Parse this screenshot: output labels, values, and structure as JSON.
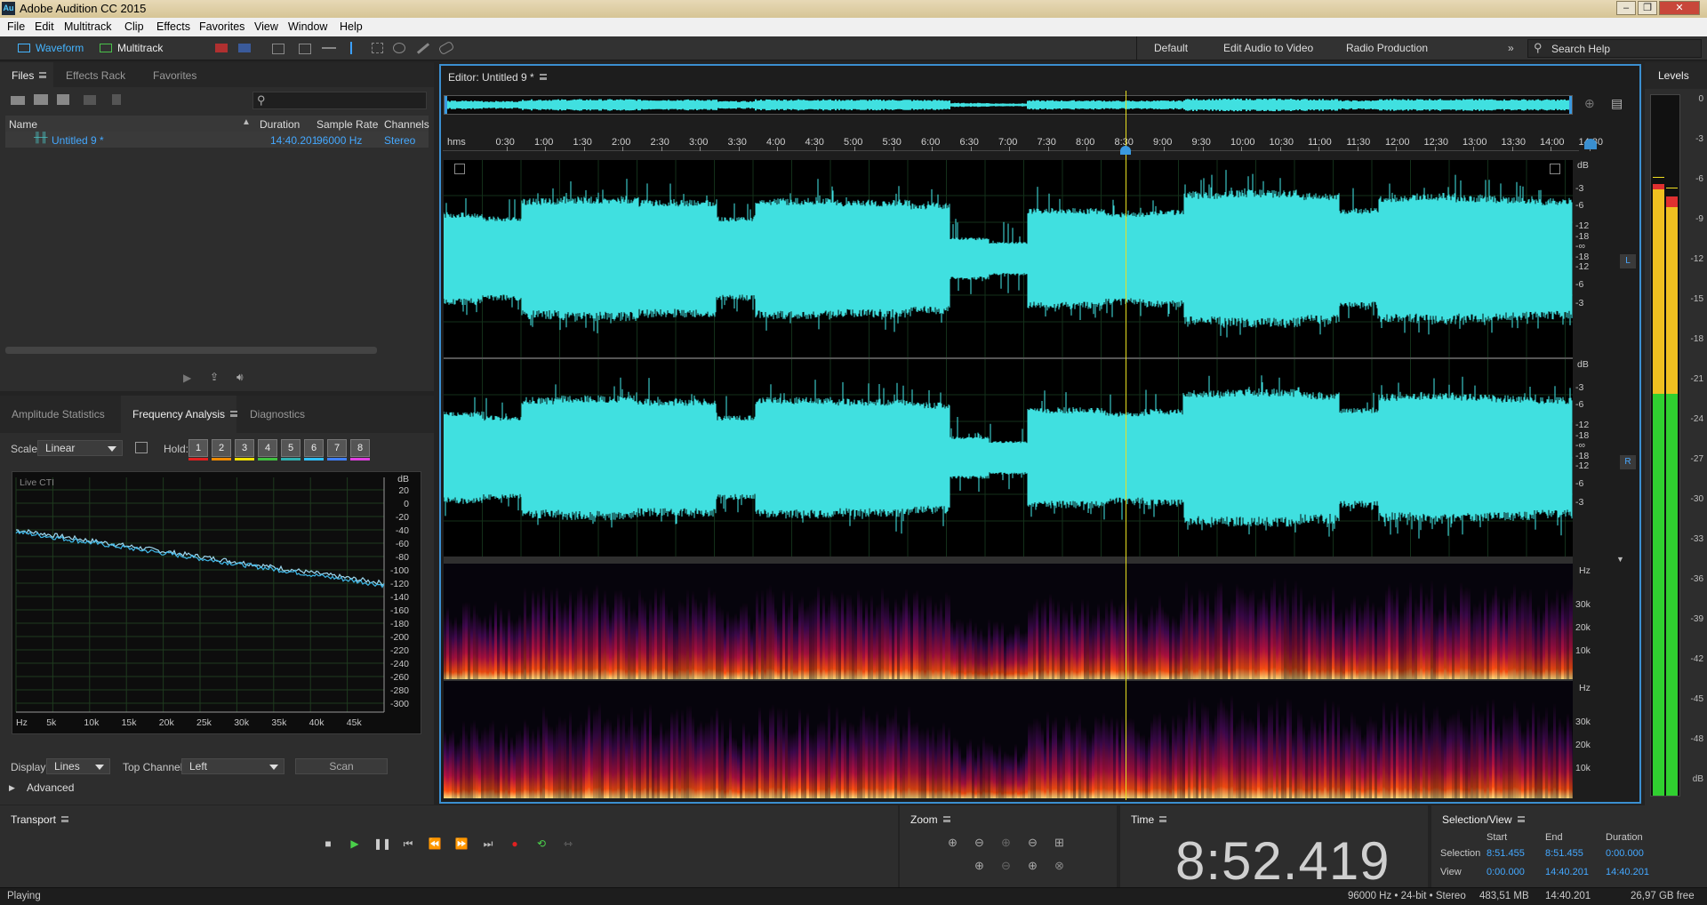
{
  "app": {
    "title": "Adobe Audition CC 2015",
    "logo_text": "Au"
  },
  "menu": [
    "File",
    "Edit",
    "Multitrack",
    "Clip",
    "Effects",
    "Favorites",
    "View",
    "Window",
    "Help"
  ],
  "toolbar": {
    "waveform": "Waveform",
    "multitrack": "Multitrack",
    "workspaces": [
      "Default",
      "Edit Audio to Video",
      "Radio Production"
    ],
    "search_placeholder": "Search Help"
  },
  "files_panel": {
    "tabs": [
      "Files",
      "Effects Rack",
      "Favorites"
    ],
    "columns": [
      "Name",
      "Duration",
      "Sample Rate",
      "Channels"
    ],
    "rows": [
      {
        "name": "Untitled 9 *",
        "duration": "14:40.201",
        "rate": "96000 Hz",
        "channels": "Stereo"
      }
    ]
  },
  "analysis_panel": {
    "tabs": [
      "Amplitude Statistics",
      "Frequency Analysis",
      "Diagnostics"
    ],
    "scale_label": "Scale:",
    "scale_value": "Linear",
    "hold_label": "Hold:",
    "hold_buttons": [
      "1",
      "2",
      "3",
      "4",
      "5",
      "6",
      "7",
      "8"
    ],
    "hold_colors": [
      "#e02020",
      "#f08a00",
      "#f0e000",
      "#40c040",
      "#30b0b0",
      "#30c0ff",
      "#4080ff",
      "#e040e0"
    ],
    "graph_label": "Live CTI",
    "db_unit": "dB",
    "db_ticks": [
      "20",
      "0",
      "-20",
      "-40",
      "-60",
      "-80",
      "-100",
      "-120",
      "-140",
      "-160",
      "-180",
      "-200",
      "-220",
      "-240",
      "-260",
      "-280",
      "-300"
    ],
    "hz_ticks": [
      "Hz",
      "5k",
      "10k",
      "15k",
      "20k",
      "25k",
      "30k",
      "35k",
      "40k",
      "45k"
    ],
    "display_label": "Display:",
    "display_value": "Lines",
    "top_channel_label": "Top Channel:",
    "top_channel_value": "Left",
    "scan_label": "Scan",
    "advanced_label": "Advanced"
  },
  "editor": {
    "title": "Editor: Untitled 9 *",
    "ruler_unit": "hms",
    "ruler": [
      "0:30",
      "1:00",
      "1:30",
      "2:00",
      "2:30",
      "3:00",
      "3:30",
      "4:00",
      "4:30",
      "5:00",
      "5:30",
      "6:00",
      "6:30",
      "7:00",
      "7:30",
      "8:00",
      "8:30",
      "9:00",
      "9:30",
      "10:00",
      "10:30",
      "11:00",
      "11:30",
      "12:00",
      "12:30",
      "13:00",
      "13:30",
      "14:00",
      "14:30"
    ],
    "db_unit": "dB",
    "db_scale": [
      "-3",
      "-6",
      "-12",
      "-18",
      "-∞",
      "-18",
      "-12",
      "-6",
      "-3"
    ],
    "channel_l": "L",
    "channel_r": "R",
    "hz_unit": "Hz",
    "hz_scale": [
      "30k",
      "20k",
      "10k"
    ],
    "playhead_time_fraction": 0.6037
  },
  "levels": {
    "title": "Levels",
    "scale": [
      "0",
      "-3",
      "-6",
      "-9",
      "-12",
      "-15",
      "-18",
      "-21",
      "-24",
      "-27",
      "-30",
      "-33",
      "-36",
      "-39",
      "-42",
      "-45",
      "-48",
      "dB"
    ]
  },
  "transport": {
    "title": "Transport"
  },
  "zoom": {
    "title": "Zoom"
  },
  "time": {
    "title": "Time",
    "value": "8:52.419"
  },
  "selection_view": {
    "title": "Selection/View",
    "headers": [
      "Start",
      "End",
      "Duration"
    ],
    "rows": [
      {
        "label": "Selection",
        "start": "8:51.455",
        "end": "8:51.455",
        "duration": "0:00.000"
      },
      {
        "label": "View",
        "start": "0:00.000",
        "end": "14:40.201",
        "duration": "14:40.201"
      }
    ]
  },
  "status": {
    "left": "Playing",
    "format": "96000 Hz • 24-bit • Stereo",
    "size": "483,51 MB",
    "duration": "14:40.201",
    "free": "26,97 GB free"
  },
  "colors": {
    "waveform": "#40e0e0",
    "accent": "#3b8fd0",
    "playhead": "#f0e020"
  }
}
